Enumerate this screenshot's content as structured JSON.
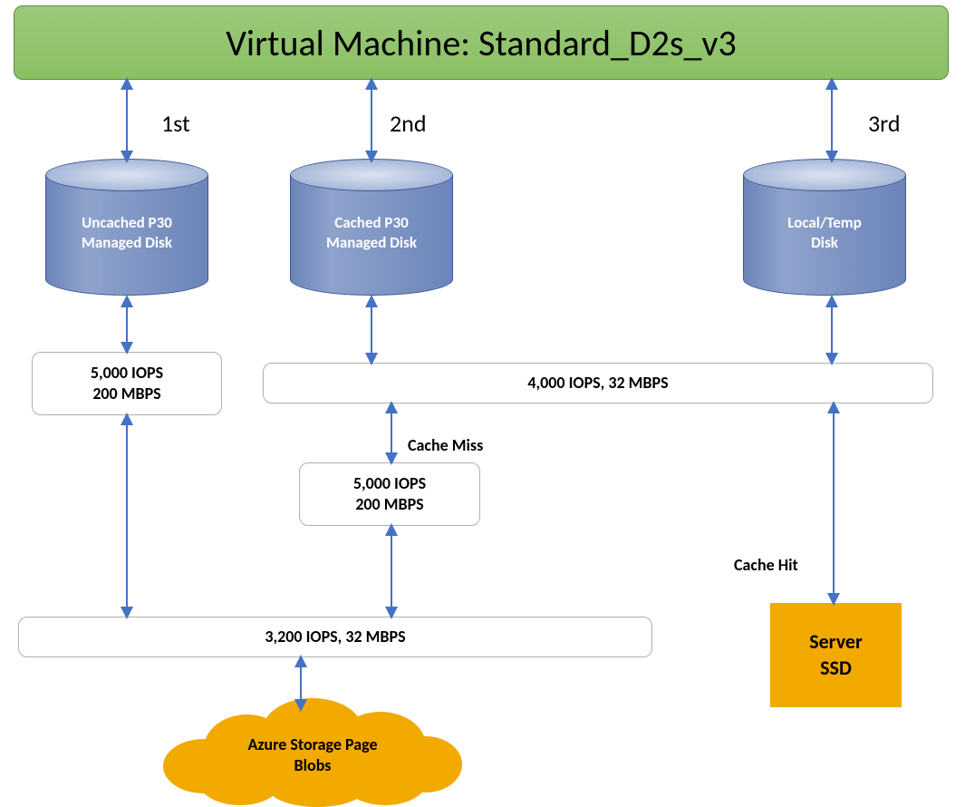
{
  "title": "Virtual Machine: Standard_D2s_v3",
  "ordinals": {
    "first": "1st",
    "second": "2nd",
    "third": "3rd"
  },
  "disks": {
    "uncached": {
      "label_l1": "Uncached P30",
      "label_l2": "Managed Disk"
    },
    "cached": {
      "label_l1": "Cached P30",
      "label_l2": "Managed Disk"
    },
    "temp": {
      "label_l1": "Local/Temp",
      "label_l2": "Disk"
    }
  },
  "stats": {
    "uncached_disk": {
      "l1": "5,000 IOPS",
      "l2": "200 MBPS"
    },
    "cached_temp_shared": "4,000 IOPS, 32 MBPS",
    "cache_miss_disk": {
      "l1": "5,000 IOPS",
      "l2": "200 MBPS"
    },
    "uncached_bus": "3,200 IOPS, 32 MBPS"
  },
  "labels": {
    "cache_miss": "Cache Miss",
    "cache_hit": "Cache Hit"
  },
  "endpoints": {
    "server_ssd_l1": "Server",
    "server_ssd_l2": "SSD",
    "cloud_l1": "Azure Storage Page",
    "cloud_l2": "Blobs"
  }
}
